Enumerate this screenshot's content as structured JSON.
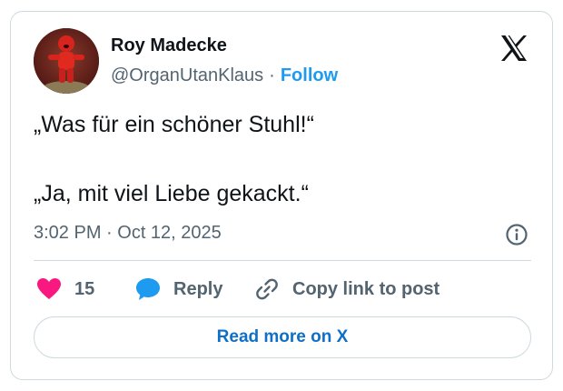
{
  "author": {
    "display_name": "Roy Madecke",
    "handle": "@OrganUtanKlaus",
    "separator": "·",
    "follow_label": "Follow",
    "avatar_icon": "red-plush-figure-avatar"
  },
  "brand": {
    "logo_icon": "x-logo-icon"
  },
  "tweet": {
    "lines": [
      "„Was für ein schöner Stuhl!“",
      "„Ja, mit viel Liebe gekackt.“"
    ],
    "timestamp": "3:02 PM · Oct 12, 2025"
  },
  "actions": {
    "like_count": "15",
    "reply_label": "Reply",
    "copy_link_label": "Copy link to post"
  },
  "footer": {
    "read_more_label": "Read more on X"
  },
  "colors": {
    "accent_blue": "#1d9bf0",
    "link_blue": "#0f6fc6",
    "like_pink": "#f91880",
    "text_primary": "#0f1419",
    "text_secondary": "#536471",
    "border": "#cfd9de"
  }
}
